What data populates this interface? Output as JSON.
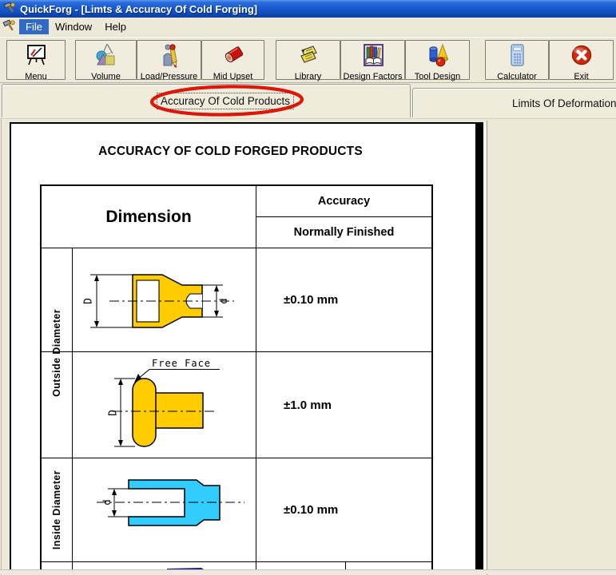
{
  "window": {
    "title": "QuickForg - [Limts & Accuracy Of Cold Forging]"
  },
  "menubar": {
    "items": [
      {
        "label": "File",
        "selected": true
      },
      {
        "label": "Window",
        "selected": false
      },
      {
        "label": "Help",
        "selected": false
      }
    ]
  },
  "toolbar": {
    "buttons": [
      {
        "label": "Menu",
        "icon": "whiteboard-icon"
      },
      {
        "label": "Volume",
        "icon": "geometry-shapes-icon"
      },
      {
        "label": "Load/Pressure",
        "icon": "pencil-figure-icon"
      },
      {
        "label": "Mid Upset",
        "icon": "red-cylinder-icon"
      },
      {
        "label": "Library",
        "icon": "yellow-notes-icon"
      },
      {
        "label": "Design Factors",
        "icon": "open-book-icon"
      },
      {
        "label": "Tool Design",
        "icon": "solids-icon"
      },
      {
        "label": "Calculator",
        "icon": "calculator-icon"
      },
      {
        "label": "Exit",
        "icon": "exit-icon"
      }
    ]
  },
  "tabs": {
    "active_label": "Accuracy Of Cold Products",
    "inactive_label": "Limits Of Deformations In"
  },
  "page": {
    "title": "ACCURACY OF COLD FORGED PRODUCTS",
    "table": {
      "col_dimension": "Dimension",
      "col_accuracy": "Accuracy",
      "col_accuracy_sub": "Normally Finished",
      "rows": [
        {
          "group": "Outside Diameter",
          "drawing": "stepped-shaft-section-yellow",
          "dims": {
            "left": "D",
            "right": "d"
          },
          "accuracy": "±0.10 mm"
        },
        {
          "group": "Outside Diameter",
          "drawing": "rivet-head-section-yellow",
          "dims": {
            "left": "D"
          },
          "note": "Free Face",
          "accuracy": "±1.0 mm"
        },
        {
          "group": "Inside Diameter",
          "drawing": "cup-section-cyan",
          "dims": {
            "left": "d"
          },
          "accuracy": "±0.10 mm"
        }
      ]
    }
  },
  "colors": {
    "part_yellow": "#FFCC00",
    "part_cyan": "#33CCFF",
    "part_navy": "#1A1A8F",
    "annotation_red": "#DE1507",
    "titlebar_blue": "#1556CC",
    "menu_select_blue": "#316AC5",
    "chrome_beige": "#ECE9D8"
  }
}
